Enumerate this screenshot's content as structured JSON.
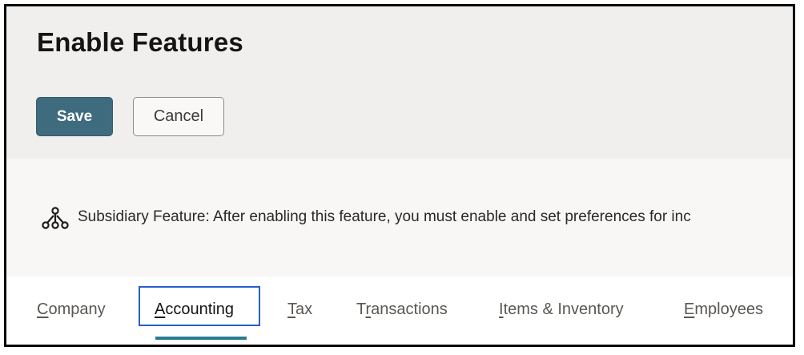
{
  "page": {
    "title": "Enable Features"
  },
  "toolbar": {
    "save_label": "Save",
    "cancel_label": "Cancel"
  },
  "info": {
    "icon": "hierarchy-icon",
    "text": "Subsidiary Feature: After enabling this feature, you must enable and set preferences for inc"
  },
  "tabs": [
    {
      "first": "C",
      "rest": "ompany"
    },
    {
      "first": "A",
      "rest": "ccounting",
      "active": true
    },
    {
      "first": "T",
      "rest": "ax"
    },
    {
      "pre": "T",
      "first": "r",
      "rest": "ansactions"
    },
    {
      "first": "I",
      "rest": "tems & Inventory"
    },
    {
      "first": "E",
      "rest": "mployees"
    }
  ],
  "colors": {
    "primary": "#3e6b7e",
    "focus": "#2c5ccf",
    "indicator": "#2b7c91"
  }
}
